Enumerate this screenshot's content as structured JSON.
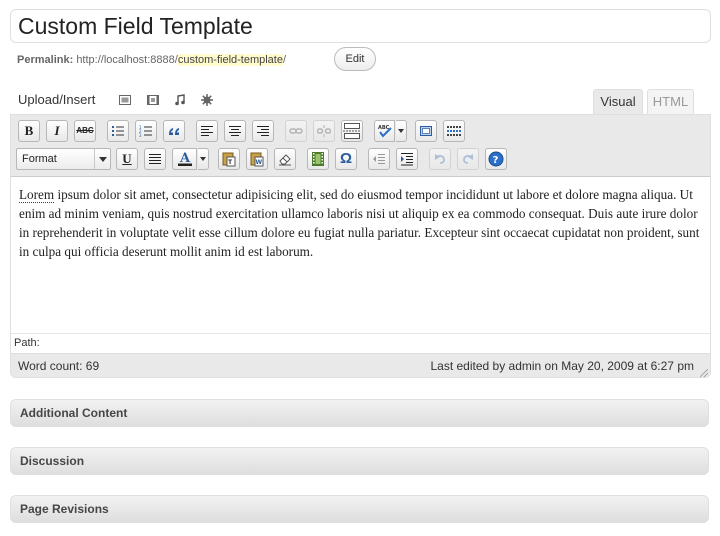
{
  "post": {
    "title": "Custom Field Template",
    "permalink_label": "Permalink:",
    "permalink_base": "http://localhost:8888/",
    "permalink_slug": "custom-field-template",
    "permalink_trail": "/",
    "edit_label": "Edit"
  },
  "media": {
    "upload_label": "Upload/Insert",
    "icons": [
      "image-icon",
      "video-icon",
      "audio-icon",
      "media-icon"
    ]
  },
  "tabs": [
    {
      "label": "Visual",
      "active": true
    },
    {
      "label": "HTML",
      "active": false
    }
  ],
  "toolbar": {
    "format_label": "Format",
    "bold_label": "B",
    "italic_label": "I",
    "strike_label": "ABC",
    "underline_label": "U",
    "omega_label": "Ω"
  },
  "editor": {
    "content_first_word": "Lorem",
    "content_rest": " ipsum dolor sit amet, consectetur adipisicing elit, sed do eiusmod tempor incididunt ut labore et dolore magna aliqua. Ut enim ad minim veniam, quis nostrud exercitation ullamco laboris nisi ut aliquip ex ea commodo consequat. Duis aute irure dolor in reprehenderit in voluptate velit esse cillum dolore eu fugiat nulla pariatur. Excepteur sint occaecat cupidatat non proident, sunt in culpa qui officia deserunt mollit anim id est laborum.",
    "path_label": "Path:",
    "word_count": "Word count: 69",
    "last_edited": "Last edited by admin on May 20, 2009 at 6:27 pm"
  },
  "boxes": [
    {
      "title": "Additional Content"
    },
    {
      "title": "Discussion"
    },
    {
      "title": "Page Revisions"
    }
  ],
  "colors": {
    "toolbar_bg": "#e9e9e9",
    "slug_highlight": "#fffbcc",
    "help_blue": "#2a6fc9"
  }
}
